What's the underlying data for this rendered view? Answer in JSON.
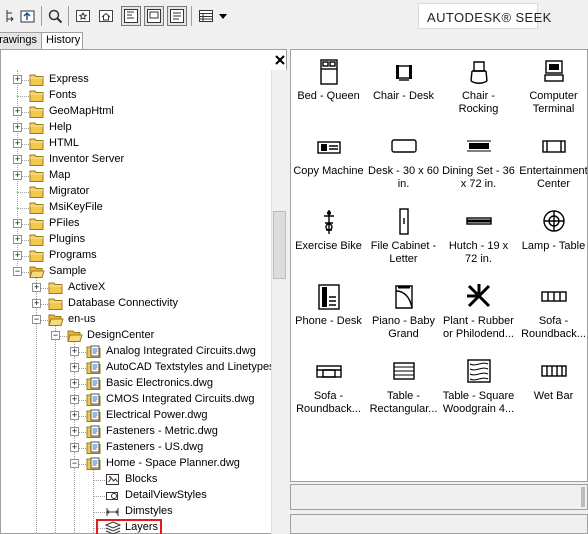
{
  "toolbar": {
    "buttons": [
      {
        "name": "tree-toggle-icon"
      },
      {
        "name": "load-icon"
      },
      {
        "name": "search-icon"
      },
      {
        "name": "favorites-icon"
      },
      {
        "name": "home-icon"
      },
      {
        "name": "tree-view-toggle-icon"
      },
      {
        "name": "preview-toggle-icon"
      },
      {
        "name": "description-toggle-icon"
      },
      {
        "name": "views-icon"
      },
      {
        "name": "views-dropdown-icon"
      }
    ],
    "seek_label": "AUTODESK® SEEK"
  },
  "tabs": [
    {
      "label": "rawings"
    },
    {
      "label": "History"
    }
  ],
  "tree": {
    "close_glyph": "✕",
    "items": [
      {
        "label": "Express",
        "indent": 0,
        "expander": "+",
        "icon": "folder"
      },
      {
        "label": "Fonts",
        "indent": 0,
        "expander": "",
        "icon": "folder"
      },
      {
        "label": "GeoMapHtml",
        "indent": 0,
        "expander": "+",
        "icon": "folder"
      },
      {
        "label": "Help",
        "indent": 0,
        "expander": "+",
        "icon": "folder"
      },
      {
        "label": "HTML",
        "indent": 0,
        "expander": "+",
        "icon": "folder"
      },
      {
        "label": "Inventor Server",
        "indent": 0,
        "expander": "+",
        "icon": "folder"
      },
      {
        "label": "Map",
        "indent": 0,
        "expander": "+",
        "icon": "folder"
      },
      {
        "label": "Migrator",
        "indent": 0,
        "expander": "",
        "icon": "folder"
      },
      {
        "label": "MsiKeyFile",
        "indent": 0,
        "expander": "",
        "icon": "folder"
      },
      {
        "label": "PFiles",
        "indent": 0,
        "expander": "+",
        "icon": "folder"
      },
      {
        "label": "Plugins",
        "indent": 0,
        "expander": "+",
        "icon": "folder"
      },
      {
        "label": "Programs",
        "indent": 0,
        "expander": "+",
        "icon": "folder"
      },
      {
        "label": "Sample",
        "indent": 0,
        "expander": "−",
        "icon": "folder-open"
      },
      {
        "label": "ActiveX",
        "indent": 1,
        "expander": "+",
        "icon": "folder"
      },
      {
        "label": "Database Connectivity",
        "indent": 1,
        "expander": "+",
        "icon": "folder"
      },
      {
        "label": "en-us",
        "indent": 1,
        "expander": "−",
        "icon": "folder-open"
      },
      {
        "label": "DesignCenter",
        "indent": 2,
        "expander": "−",
        "icon": "folder-open"
      },
      {
        "label": "Analog Integrated Circuits.dwg",
        "indent": 3,
        "expander": "+",
        "icon": "dwg"
      },
      {
        "label": "AutoCAD Textstyles and Linetypes.",
        "indent": 3,
        "expander": "+",
        "icon": "dwg"
      },
      {
        "label": "Basic Electronics.dwg",
        "indent": 3,
        "expander": "+",
        "icon": "dwg"
      },
      {
        "label": "CMOS Integrated Circuits.dwg",
        "indent": 3,
        "expander": "+",
        "icon": "dwg"
      },
      {
        "label": "Electrical Power.dwg",
        "indent": 3,
        "expander": "+",
        "icon": "dwg"
      },
      {
        "label": "Fasteners - Metric.dwg",
        "indent": 3,
        "expander": "+",
        "icon": "dwg"
      },
      {
        "label": "Fasteners - US.dwg",
        "indent": 3,
        "expander": "+",
        "icon": "dwg"
      },
      {
        "label": "Home - Space Planner.dwg",
        "indent": 3,
        "expander": "−",
        "icon": "dwg"
      },
      {
        "label": "Blocks",
        "indent": 4,
        "expander": "",
        "icon": "blocks"
      },
      {
        "label": "DetailViewStyles",
        "indent": 4,
        "expander": "",
        "icon": "detailview"
      },
      {
        "label": "Dimstyles",
        "indent": 4,
        "expander": "",
        "icon": "dimstyles"
      },
      {
        "label": "Layers",
        "indent": 4,
        "expander": "",
        "icon": "layers"
      }
    ]
  },
  "blocks": [
    {
      "label": "Bed - Queen",
      "icon": "bed"
    },
    {
      "label": "Chair - Desk",
      "icon": "chair-desk"
    },
    {
      "label": "Chair -\nRocking",
      "icon": "chair-rocking"
    },
    {
      "label": "Computer\nTerminal",
      "icon": "computer"
    },
    {
      "label": "Copy Machine",
      "icon": "copier"
    },
    {
      "label": "Desk - 30 x 60\nin.",
      "icon": "desk"
    },
    {
      "label": "Dining Set - 36\nx 72 in.",
      "icon": "dining"
    },
    {
      "label": "Entertainment\nCenter",
      "icon": "entertainment"
    },
    {
      "label": "Exercise Bike",
      "icon": "bike"
    },
    {
      "label": "File Cabinet -\nLetter",
      "icon": "cabinet"
    },
    {
      "label": "Hutch - 19 x\n72 in.",
      "icon": "hutch"
    },
    {
      "label": "Lamp - Table",
      "icon": "lamp"
    },
    {
      "label": "Phone - Desk",
      "icon": "phone"
    },
    {
      "label": "Piano - Baby\nGrand",
      "icon": "piano"
    },
    {
      "label": "Plant - Rubber\nor Philodend...",
      "icon": "plant"
    },
    {
      "label": "Sofa -\nRoundback...",
      "icon": "sofa1"
    },
    {
      "label": "Sofa -\nRoundback...",
      "icon": "sofa2"
    },
    {
      "label": "Table -\nRectangular...",
      "icon": "table-rect"
    },
    {
      "label": "Table - Square\nWoodgrain 4...",
      "icon": "table-wood"
    },
    {
      "label": "Wet Bar",
      "icon": "wetbar"
    }
  ],
  "selected_tree_item": "Blocks",
  "colors": {
    "highlight_border": "#e21b22",
    "folder": "#f2c94c",
    "panel_border": "#a0a0a0"
  }
}
